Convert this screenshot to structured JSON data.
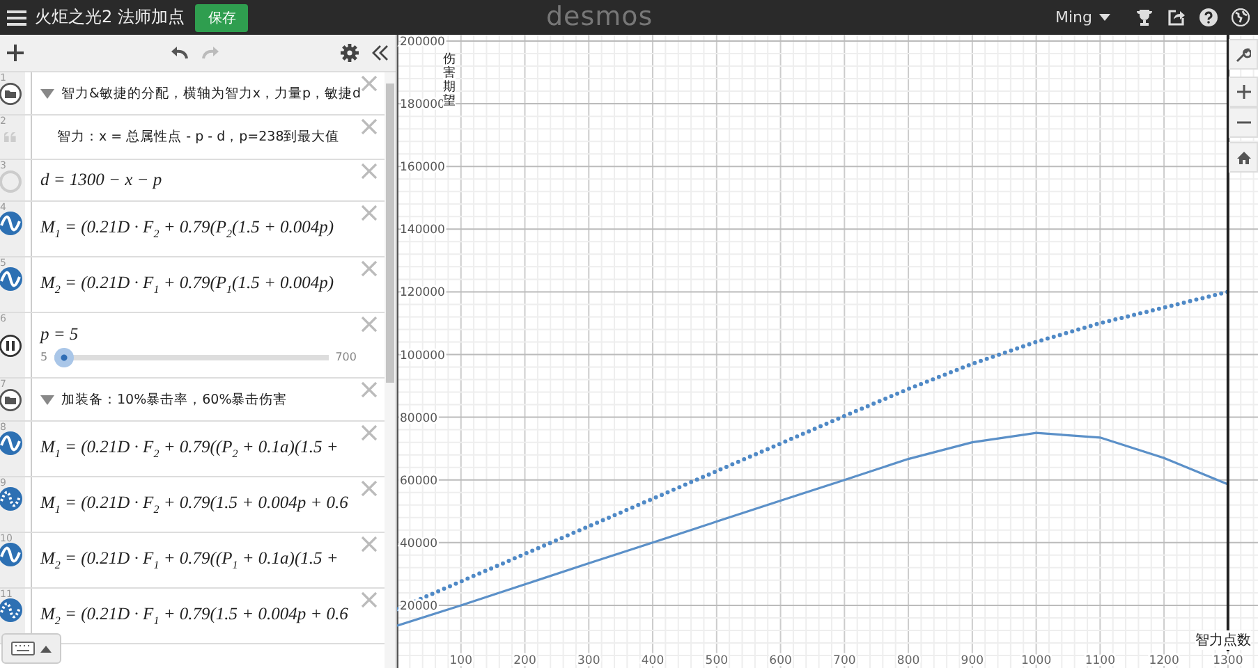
{
  "header": {
    "title": "火炬之光2 法师加点",
    "save_button": "保存",
    "logo": "desmos",
    "user": "Ming"
  },
  "expressions": [
    {
      "index": "1",
      "kind": "folder",
      "text": "智力&敏捷的分配，横轴为智力x，力量p，敏捷d",
      "expanded": true
    },
    {
      "index": "2",
      "kind": "note",
      "text": "智力：x = 总属性点 - p - d，p=238到最大值"
    },
    {
      "index": "3",
      "kind": "hidden",
      "math": "d = 1300 − x − p"
    },
    {
      "index": "4",
      "kind": "curve",
      "math": "M$_{1}$ = (0.21D · F$_{2}$ + 0.79(P$_{2}$(1.5 + 0.004p)"
    },
    {
      "index": "5",
      "kind": "curve",
      "math": "M$_{2}$ = (0.21D · F$_{1}$ + 0.79(P$_{1}$(1.5 + 0.004p)"
    },
    {
      "index": "6",
      "kind": "slider",
      "math": "p = 5",
      "min": "5",
      "max": "700",
      "level": 0,
      "playing": true
    },
    {
      "index": "7",
      "kind": "folder",
      "text": "加装备：10%暴击率，60%暴击伤害",
      "expanded": true
    },
    {
      "index": "8",
      "kind": "curve",
      "math": "M$_{1}$ = (0.21D · F$_{2}$ + 0.79((P$_{2}$ + 0.1a)(1.5 +"
    },
    {
      "index": "9",
      "kind": "points",
      "math": "M$_{1}$ = (0.21D · F$_{2}$ + 0.79(1.5 + 0.004p + 0.6"
    },
    {
      "index": "10",
      "kind": "curve",
      "math": "M$_{2}$ = (0.21D · F$_{1}$ + 0.79((P$_{1}$ + 0.1a)(1.5 +"
    },
    {
      "index": "11",
      "kind": "points",
      "math": "M$_{2}$ = (0.21D · F$_{1}$ + 0.79(1.5 + 0.004p + 0.6"
    }
  ],
  "graph": {
    "chart_data": {
      "type": "line",
      "xlabel": "智力点数",
      "ylabel": "伤害期望",
      "x": [
        0,
        100,
        200,
        300,
        400,
        500,
        600,
        700,
        800,
        900,
        1000,
        1100,
        1200,
        1300
      ],
      "series": [
        {
          "color": "#4f89c6",
          "line_style": "dotted",
          "values": [
            18800,
            27600,
            36400,
            45200,
            54000,
            62800,
            71600,
            80400,
            89000,
            97000,
            104000,
            110000,
            115000,
            120000
          ]
        },
        {
          "color": "#5b90c8",
          "line_style": "solid",
          "values": [
            13500,
            20000,
            26700,
            33400,
            40000,
            46700,
            53400,
            60000,
            66700,
            72000,
            75000,
            73500,
            67000,
            58600
          ]
        }
      ],
      "xlim": [
        0,
        1347
      ],
      "ylim": [
        0,
        202000
      ],
      "xticks": [
        100,
        200,
        300,
        400,
        500,
        600,
        700,
        800,
        900,
        1000,
        1100,
        1200,
        1300
      ],
      "yticks": [
        20000,
        40000,
        60000,
        80000,
        100000,
        120000,
        140000,
        160000,
        180000,
        200000
      ],
      "grid": true,
      "ref_lines": [
        {
          "axis": "x",
          "value": 1300
        }
      ]
    }
  }
}
